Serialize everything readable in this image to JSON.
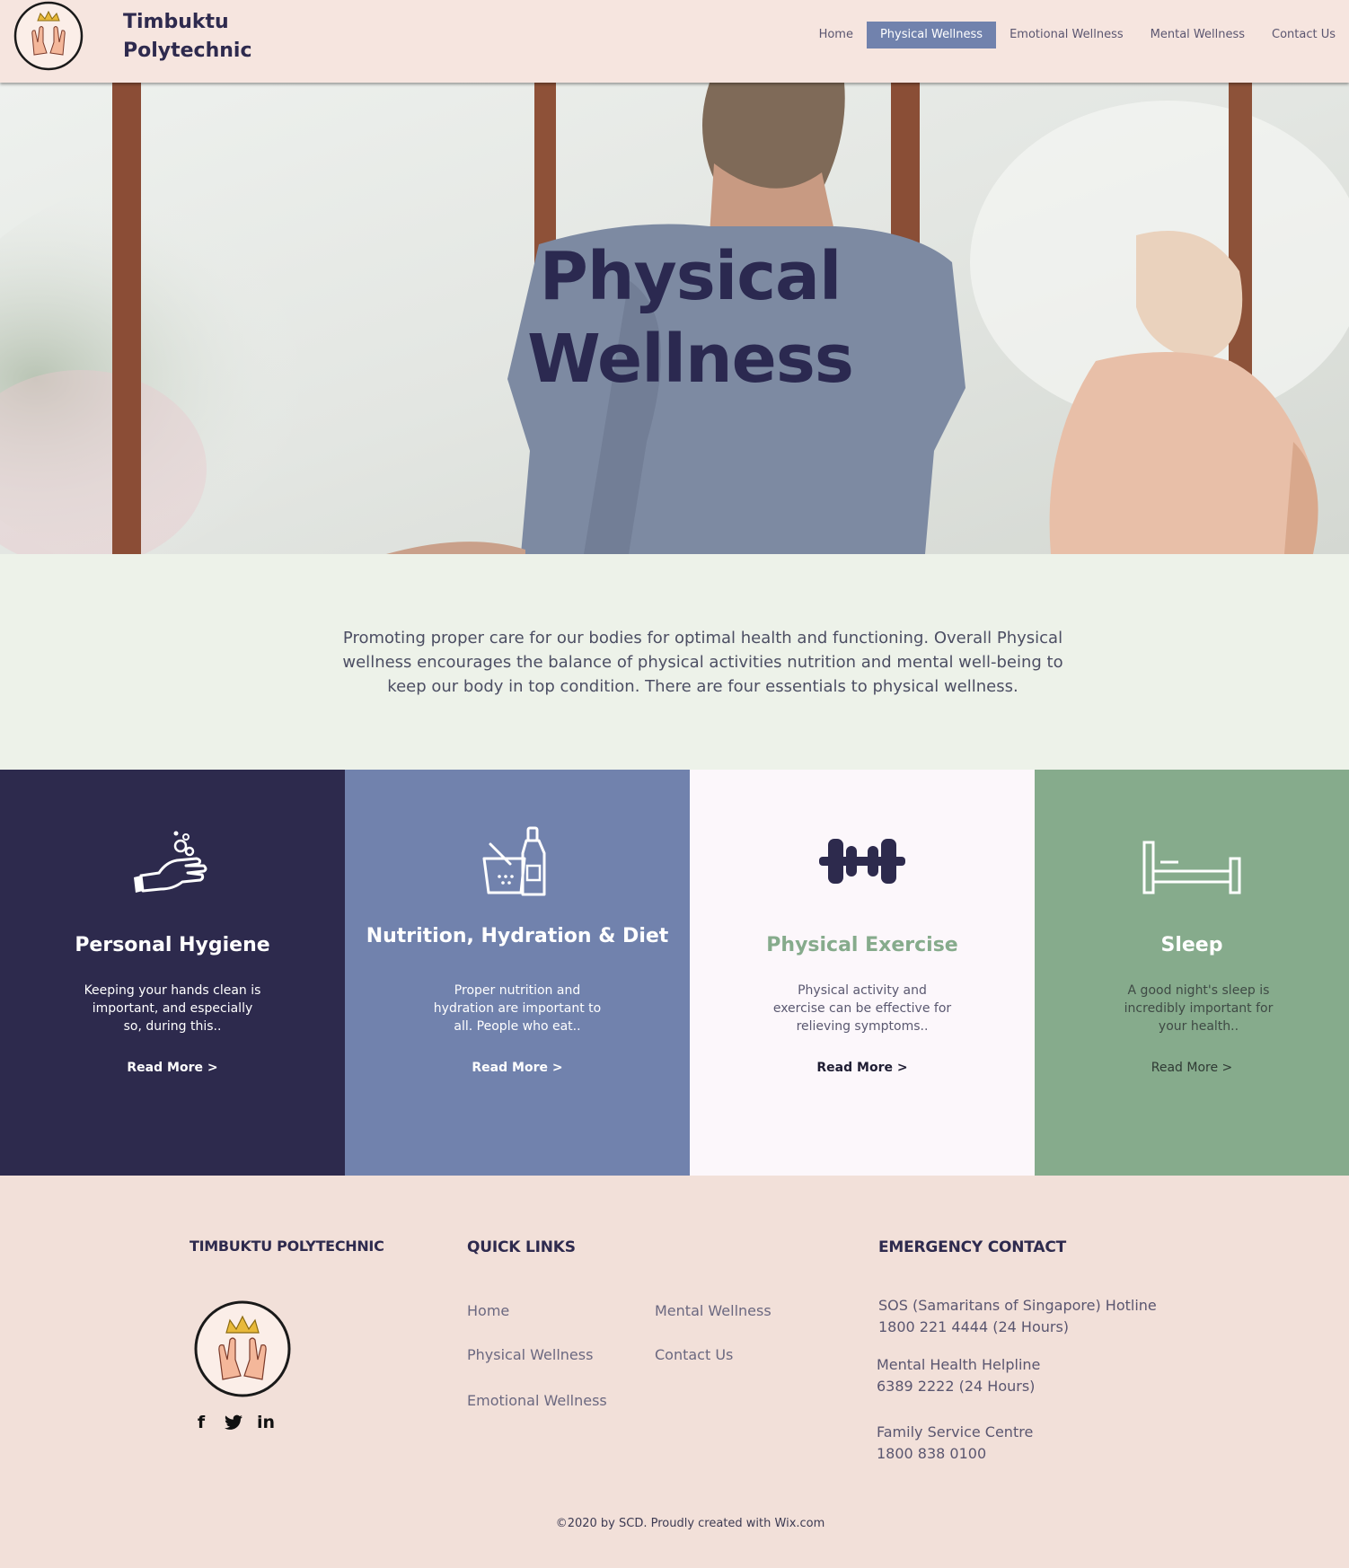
{
  "header": {
    "brand_line1": "Timbuktu",
    "brand_line2": "Polytechnic",
    "nav": [
      {
        "label": "Home"
      },
      {
        "label": "Physical Wellness"
      },
      {
        "label": "Emotional Wellness"
      },
      {
        "label": "Mental Wellness"
      },
      {
        "label": "Contact Us"
      }
    ],
    "active_nav": "Physical Wellness"
  },
  "hero": {
    "title_line1": "Physical",
    "title_line2": "Wellness"
  },
  "intro": {
    "text": "Promoting proper care for our bodies for optimal health and functioning. Overall Physical wellness encourages the balance of physical activities nutrition and mental well-being to keep our body in top condition. There are four essentials to physical wellness."
  },
  "cards": [
    {
      "icon": "hand-washing-icon",
      "title": "Personal Hygiene",
      "desc": "Keeping your hands clean is important, and especially so, during this..",
      "link": "Read More >"
    },
    {
      "icon": "nutrition-basket-icon",
      "title": "Nutrition, Hydration & Diet",
      "desc": "Proper nutrition and hydration are important to all. People who eat..",
      "link": "Read More >"
    },
    {
      "icon": "dumbbell-icon",
      "title": "Physical Exercise",
      "desc": "Physical activity and exercise can be effective for relieving symptoms..",
      "link": "Read More >"
    },
    {
      "icon": "bed-icon",
      "title": "Sleep",
      "desc": "A good night's sleep is incredibly important for your health..",
      "link": "Read More >"
    }
  ],
  "footer": {
    "brand": "TIMBUKTU POLYTECHNIC",
    "socials": [
      {
        "icon": "facebook-icon",
        "glyph": "f"
      },
      {
        "icon": "twitter-icon",
        "glyph": "🐦"
      },
      {
        "icon": "linkedin-icon",
        "glyph": "in"
      }
    ],
    "quick_links_heading": "QUICK LINKS",
    "quick_links": [
      "Home",
      "Physical Wellness",
      "Emotional Wellness",
      "Mental Wellness",
      "Contact Us"
    ],
    "emergency_heading": "EMERGENCY CONTACT",
    "contacts": [
      {
        "name": "SOS (Samaritans of Singapore) Hotline",
        "number": "1800 221 4444 (24 Hours)"
      },
      {
        "name": "Mental Health Helpline",
        "number": "6389 2222 (24 Hours)"
      },
      {
        "name": "Family Service Centre",
        "number": "1800 838 0100"
      }
    ],
    "copyright": "©2020 by SCD. Proudly created with Wix.com"
  },
  "colors": {
    "navy": "#2d2a4d",
    "periwinkle": "#7182ad",
    "sage": "#86ab8c",
    "blush": "#f2e0d9",
    "mint": "#edf2e9"
  }
}
